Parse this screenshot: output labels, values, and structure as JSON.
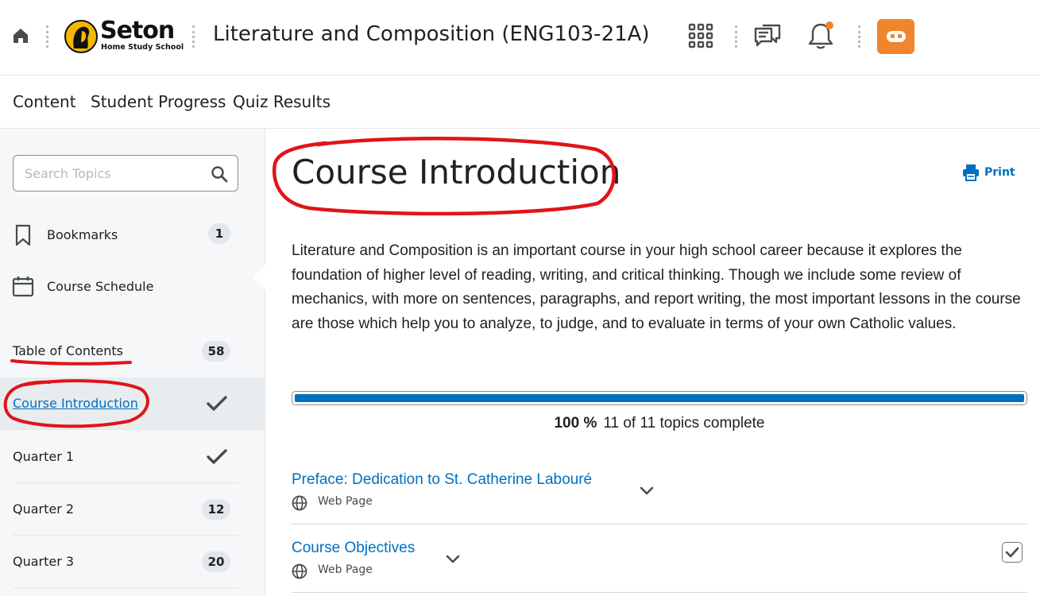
{
  "header": {
    "logo_word": "Seton",
    "logo_sub": "Home Study School",
    "course_title": "Literature and Composition (ENG103-21A)",
    "icons": [
      "home-icon",
      "waffle-icon",
      "message-icon",
      "notification-bell-icon",
      "avatar-icon"
    ],
    "notification_dot_color": "#f0852d",
    "avatar_color": "#f0852d"
  },
  "nav": {
    "items": [
      {
        "label": "Content"
      },
      {
        "label": "Student Progress"
      },
      {
        "label": "Quiz Results"
      }
    ]
  },
  "sidebar": {
    "search_placeholder": "Search Topics",
    "bookmarks": {
      "label": "Bookmarks",
      "count": "1"
    },
    "schedule": {
      "label": "Course Schedule"
    },
    "toc": {
      "label": "Table of Contents",
      "count": "58"
    },
    "modules": [
      {
        "label": "Course Introduction",
        "status": "complete",
        "active": true
      },
      {
        "label": "Quarter 1",
        "status": "complete"
      },
      {
        "label": "Quarter 2",
        "count": "12"
      },
      {
        "label": "Quarter 3",
        "count": "20"
      }
    ]
  },
  "main": {
    "title": "Course Introduction",
    "print_label": "Print",
    "intro": "Literature and Composition is an important course in your high school career because it explores the foundation of higher level of reading, writing, and critical thinking. Though we include some review of mechanics, with more on sentences, paragraphs, and report writing, the most important lessons in the course are those which help you to analyze, to judge, and to evaluate in terms of your own Catholic values.",
    "progress": {
      "percent_label": "100 %",
      "summary": "11 of 11 topics complete",
      "fraction": 1.0,
      "color": "#006fbf"
    },
    "topics": [
      {
        "title": "Preface: Dedication to St. Catherine Labouré",
        "type": "Web Page",
        "completed": false
      },
      {
        "title": "Course Objectives",
        "type": "Web Page",
        "completed": true
      }
    ]
  },
  "colors": {
    "link": "#006fbf",
    "annotation": "#e0141a"
  }
}
